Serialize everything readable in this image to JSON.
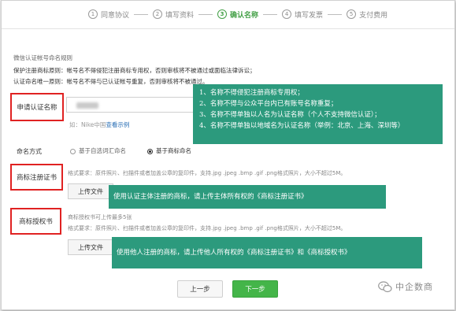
{
  "steps": [
    {
      "num": "1",
      "label": "同意协议"
    },
    {
      "num": "2",
      "label": "填写资料"
    },
    {
      "num": "3",
      "label": "确认名称"
    },
    {
      "num": "4",
      "label": "填写发票"
    },
    {
      "num": "5",
      "label": "支付费用"
    }
  ],
  "rules": {
    "title": "微信认证帐号命名规则",
    "line1": "保护注册商标原则：帐号名不得侵犯注册商标专用权，否则审核将不被通过或面临法律诉讼；",
    "line2": "认证命名唯一原则：帐号名不得与已认证帐号重复，否则审核将不被通过。"
  },
  "form": {
    "name_label": "申请认证名称",
    "name_hint": "如：Nike中国",
    "name_example_link": "查看示例",
    "naming_label": "命名方式",
    "option_auto": "基于自选词汇命名",
    "option_trademark": "基于商标命名",
    "trademark_cert_label": "商标注册证书",
    "trademark_auth_label": "商标授权书",
    "format_req": "格式要求：原件照片、扫描件或者加盖公章的复印件，支持.jpg .jpeg .bmp .gif .png格式照片，大小不超过5M。",
    "auth_limit": "商标授权书可上传最多5张",
    "upload_label": "上传文件",
    "upload_label2": "上传文件"
  },
  "callouts": {
    "name_rules": [
      "1、名称不得侵犯注册商标专用权；",
      "2、名称不得与公众平台内已有账号名称重复；",
      "3、名称不得单独以人名为认证名称（个人不支持微信认证）；",
      "4、名称不得单独以地域名为认证名称（举例：北京、上海、深圳等）"
    ],
    "own_trademark": "使用认证主体注册的商标，请上传主体所有权的《商标注册证书》",
    "other_trademark": "使用他人注册的商标，请上传他人所有权的《商标注册证书》和《商标授权书》"
  },
  "buttons": {
    "prev": "上一步",
    "next": "下一步"
  },
  "watermark": {
    "text": "中企数商"
  },
  "colors": {
    "accent": "#44b549",
    "callout": "#2c9a7d",
    "highlight": "#e02222"
  }
}
